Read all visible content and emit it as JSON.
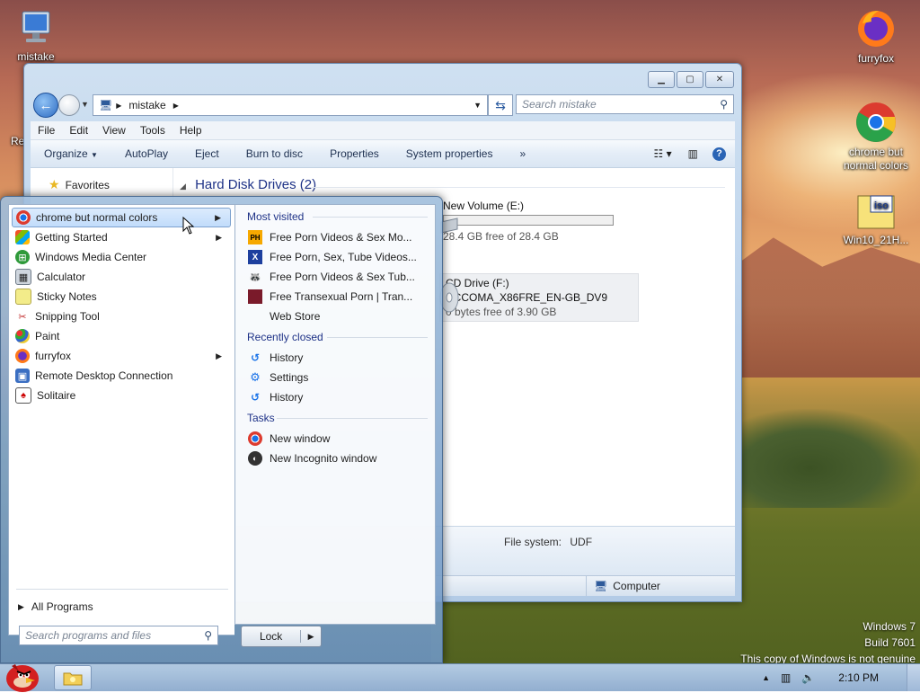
{
  "desktop": {
    "icons": [
      {
        "label": "mistake",
        "icon": "monitor-icon"
      },
      {
        "label": "furryfox",
        "icon": "firefox-icon"
      },
      {
        "label": "chrome but normal colors",
        "icon": "chrome-icon"
      },
      {
        "label": "Win10_21H...",
        "icon": "iso-file-icon",
        "badge": "iso"
      }
    ],
    "partial_left_label": "Re",
    "watermark": {
      "line1": "Windows 7",
      "line2": "Build 7601",
      "line3": "This copy of Windows is not genuine"
    }
  },
  "explorer": {
    "address": "mistake",
    "search_placeholder": "Search mistake",
    "menu": [
      "File",
      "Edit",
      "View",
      "Tools",
      "Help"
    ],
    "commands": [
      "Organize",
      "AutoPlay",
      "Eject",
      "Burn to disc",
      "Properties",
      "System properties",
      "»"
    ],
    "nav_favorites": "Favorites",
    "group_title": "Hard Disk Drives (2)",
    "drives": [
      {
        "name": "New Volume (E:)",
        "free": "28.4 GB free of 28.4 GB",
        "used_fraction": 0.0
      },
      {
        "name": "CD Drive (F:)",
        "label": "CCCOMA_X86FRE_EN-GB_DV9",
        "free": "0 bytes free of 3.90 GB"
      }
    ],
    "details": {
      "label": "File system:",
      "value": "UDF"
    },
    "status": "Computer"
  },
  "start_menu": {
    "programs": [
      {
        "label": "chrome but normal colors",
        "icon": "chrome-icon",
        "submenu": true,
        "highlight": true
      },
      {
        "label": "Getting Started",
        "icon": "getting-started-icon",
        "submenu": true
      },
      {
        "label": "Windows Media Center",
        "icon": "media-center-icon",
        "submenu": false
      },
      {
        "label": "Calculator",
        "icon": "calculator-icon",
        "submenu": false
      },
      {
        "label": "Sticky Notes",
        "icon": "sticky-notes-icon",
        "submenu": false
      },
      {
        "label": "Snipping Tool",
        "icon": "snipping-tool-icon",
        "submenu": false
      },
      {
        "label": "Paint",
        "icon": "paint-icon",
        "submenu": false
      },
      {
        "label": "furryfox",
        "icon": "firefox-icon",
        "submenu": true
      },
      {
        "label": "Remote Desktop Connection",
        "icon": "remote-desktop-icon",
        "submenu": false
      },
      {
        "label": "Solitaire",
        "icon": "solitaire-icon",
        "submenu": false
      }
    ],
    "all_programs": "All Programs",
    "search_placeholder": "Search programs and files",
    "lock_label": "Lock",
    "jumplist": {
      "most_visited_title": "Most visited",
      "most_visited": [
        {
          "label": "Free Porn Videos & Sex Mo...",
          "badge": "PH"
        },
        {
          "label": "Free Porn, Sex, Tube Videos...",
          "badge": "X"
        },
        {
          "label": "Free Porn Videos & Sex Tub...",
          "badge": "🦝"
        },
        {
          "label": "Free Transexual Porn | Tran...",
          "badge": "▮"
        },
        {
          "label": "Web Store",
          "badge": ""
        }
      ],
      "recently_closed_title": "Recently closed",
      "recently_closed": [
        {
          "label": "History",
          "icon": "history-icon"
        },
        {
          "label": "Settings",
          "icon": "settings-icon"
        },
        {
          "label": "History",
          "icon": "history-icon"
        }
      ],
      "tasks_title": "Tasks",
      "tasks": [
        {
          "label": "New window",
          "icon": "chrome-icon"
        },
        {
          "label": "New Incognito window",
          "icon": "incognito-icon"
        }
      ]
    }
  },
  "taskbar": {
    "clock": "2:10 PM"
  }
}
